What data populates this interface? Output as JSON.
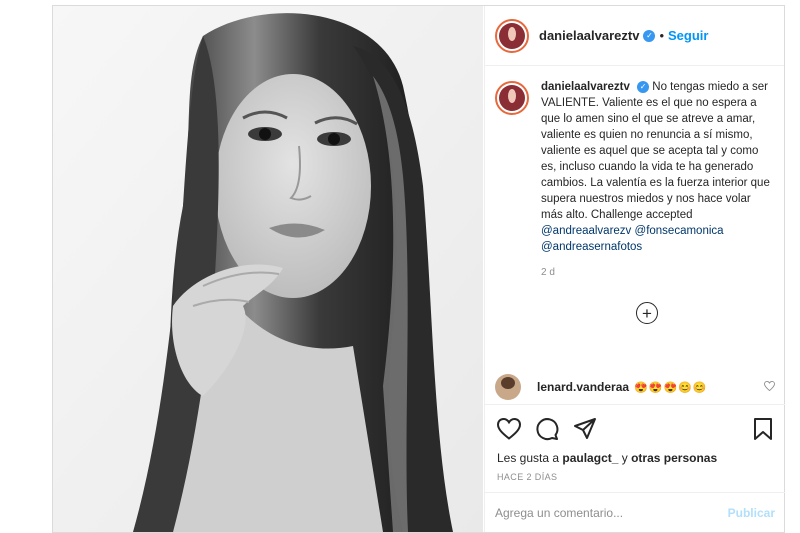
{
  "post": {
    "author": "danielaalvareztv",
    "follow_label": "Seguir",
    "separator": "•",
    "verified_glyph": "✓"
  },
  "caption": {
    "author": "danielaalvareztv",
    "text": "No tengas miedo a ser VALIENTE. Valiente es el que no espera a que lo amen sino el que se atreve a amar, valiente es quien no renuncia a sí mismo, valiente es aquel que se acepta tal y como es, incluso cuando la vida te ha generado cambios. La valentía es la fuerza interior que supera nuestros miedos y nos hace volar más alto.",
    "challenge_prefix": "Challenge accepted",
    "mentions": [
      "@andreaalvarezv",
      "@fonsecamonica",
      "@andreasernafotos"
    ],
    "age": "2 d"
  },
  "more_button": "+",
  "comment": {
    "author": "lenard.vanderaa",
    "emojis": "😍😍😍😊😊"
  },
  "likes": {
    "prefix": "Les gusta a",
    "user": "paulagct_",
    "middle": "y",
    "others": "otras personas"
  },
  "timestamp": "HACE 2 DÍAS",
  "add_comment": {
    "placeholder": "Agrega un comentario...",
    "publish_label": "Publicar"
  },
  "icons": {
    "like": "heart-icon",
    "comment": "comment-icon",
    "share": "share-icon",
    "save": "bookmark-icon",
    "more": "plus-circle-icon",
    "comment_like": "small-heart-icon"
  },
  "colors": {
    "link": "#0095f6",
    "verified": "#3897f0",
    "muted": "#8e8e8e",
    "publish_disabled": "#b2dffc"
  }
}
